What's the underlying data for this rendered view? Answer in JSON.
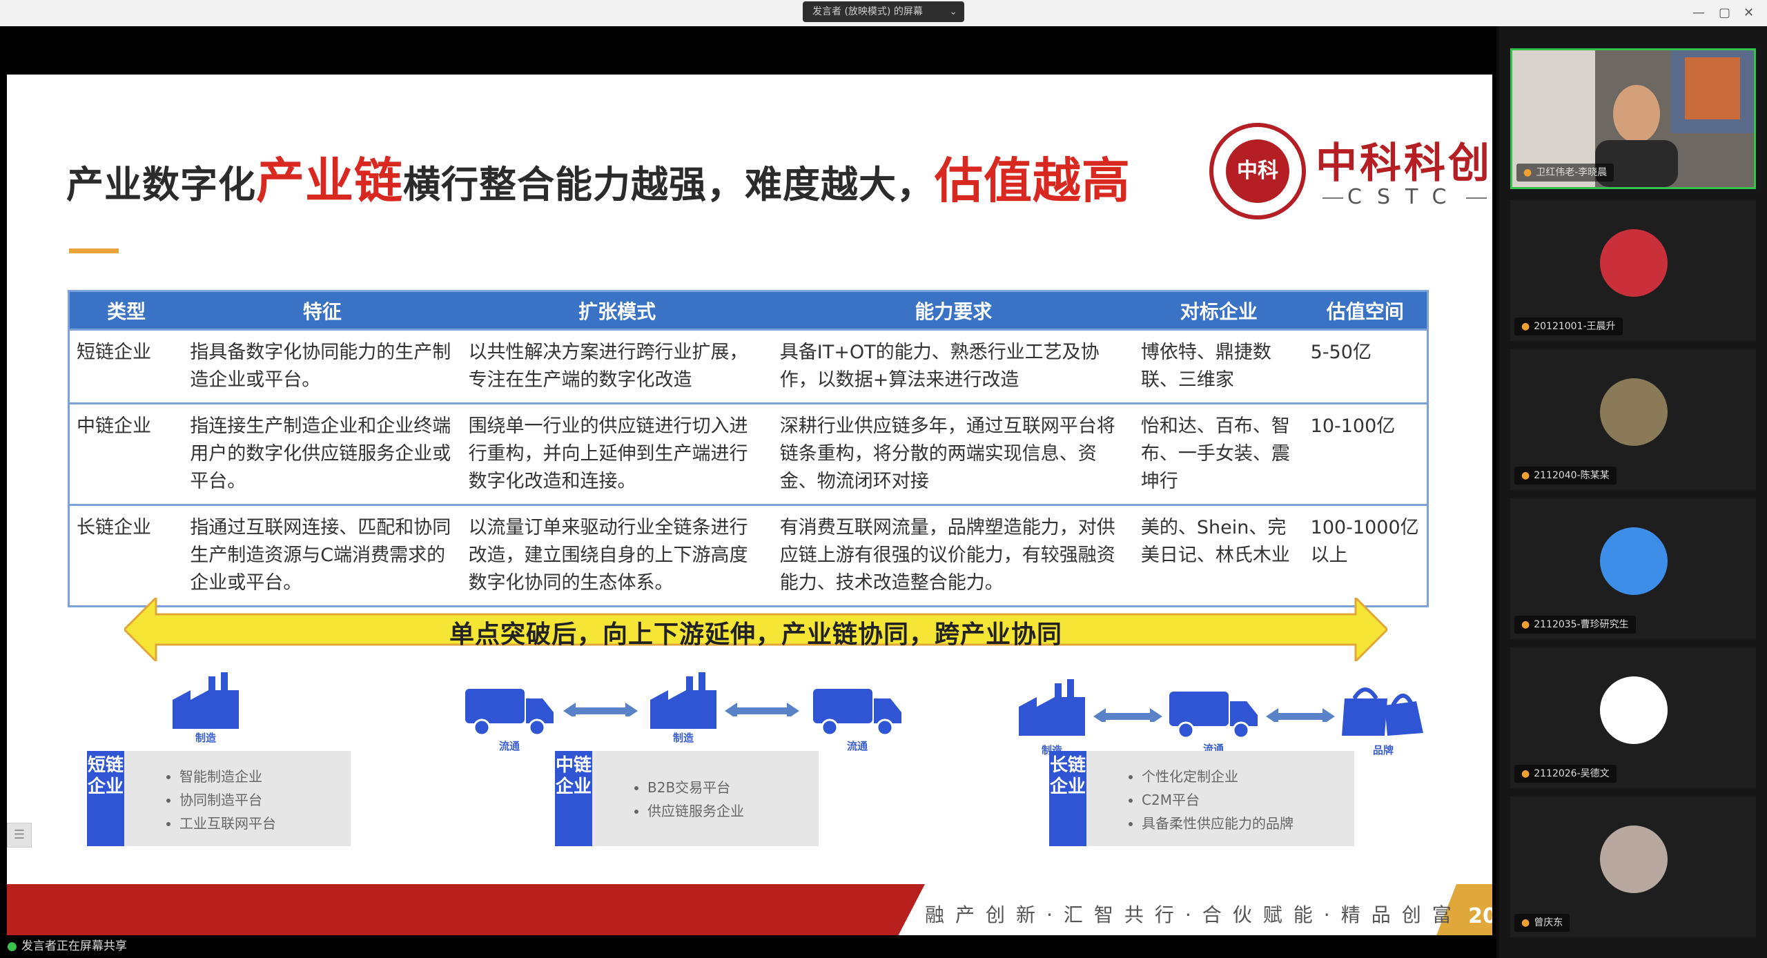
{
  "window": {
    "title": "发言者 (放映模式) 的屏幕",
    "controls": [
      "—",
      "▢",
      "✕"
    ]
  },
  "slide": {
    "title_parts": [
      "产业数字化",
      "产业链",
      "横行整合能力越强，难度越大，",
      "估值越高"
    ],
    "logo_cn": "中科科创",
    "logo_en": "CSTC",
    "logo_seal": "中科",
    "table": {
      "headers": [
        "类型",
        "特征",
        "扩张模式",
        "能力要求",
        "对标企业",
        "估值空间"
      ],
      "rows": [
        [
          "短链企业",
          "指具备数字化协同能力的生产制造企业或平台。",
          "以共性解决方案进行跨行业扩展，专注在生产端的数字化改造",
          "具备IT+OT的能力、熟悉行业工艺及协作，以数据+算法来进行改造",
          "博依特、鼎捷数联、三维家",
          "5-50亿"
        ],
        [
          "中链企业",
          "指连接生产制造企业和企业终端用户的数字化供应链服务企业或平台。",
          "围绕单一行业的供应链进行切入进行重构，并向上延伸到生产端进行数字化改造和连接。",
          "深耕行业供应链多年，通过互联网平台将链条重构，将分散的两端实现信息、资金、物流闭环对接",
          "怡和达、百布、智布、一手女装、震坤行",
          "10-100亿"
        ],
        [
          "长链企业",
          "指通过互联网连接、匹配和协同生产制造资源与C端消费需求的企业或平台。",
          "以流量订单来驱动行业全链条进行改造，建立围绕自身的上下游高度数字化协同的生态体系。",
          "有消费互联网流量，品牌塑造能力，对供应链上游有很强的议价能力，有较强融资能力、技术改造整合能力。",
          "美的、Shein、完美日记、林氏木业",
          "100-1000亿以上"
        ]
      ]
    },
    "arrow_text": "单点突破后，向上下游延伸，产业链协同，跨产业协同",
    "icons": {
      "make": "制造",
      "flow": "流通",
      "brand": "品牌"
    },
    "categories": [
      {
        "tag": "短链企业",
        "items": [
          "智能制造企业",
          "协同制造平台",
          "工业互联网平台"
        ]
      },
      {
        "tag": "中链企业",
        "items": [
          "B2B交易平台",
          "供应链服务企业"
        ]
      },
      {
        "tag": "长链企业",
        "items": [
          "个性化定制企业",
          "C2M平台",
          "具备柔性供应能力的品牌"
        ]
      }
    ],
    "footer_text": "融产创新·汇智共行·合伙赋能·精品创富",
    "page_number": "20"
  },
  "status_bar": {
    "text": "发言者正在屏幕共享"
  },
  "participants": [
    {
      "name": "卫红伟老-李晓晨",
      "type": "camera"
    },
    {
      "name": "20121001-王晨升",
      "type": "avatar",
      "color": "#c9303a"
    },
    {
      "name": "2112040-陈某某",
      "type": "avatar",
      "color": "#8a7a58"
    },
    {
      "name": "2112035-曹珍研究生",
      "type": "avatar",
      "color": "#3c8ee8"
    },
    {
      "name": "2112026-吴德文",
      "type": "avatar",
      "color": "#ffffff"
    },
    {
      "name": "曾庆东",
      "type": "avatar",
      "color": "#b8a8a0"
    }
  ],
  "colors": {
    "header_blue": "#3a73c6",
    "tag_blue": "#2f55d4",
    "title_red": "#d9281f",
    "footer_red": "#b8201e",
    "accent_gold": "#e0a73a",
    "arrow_yellow": "#f5e535",
    "active_green": "#35c24a"
  }
}
